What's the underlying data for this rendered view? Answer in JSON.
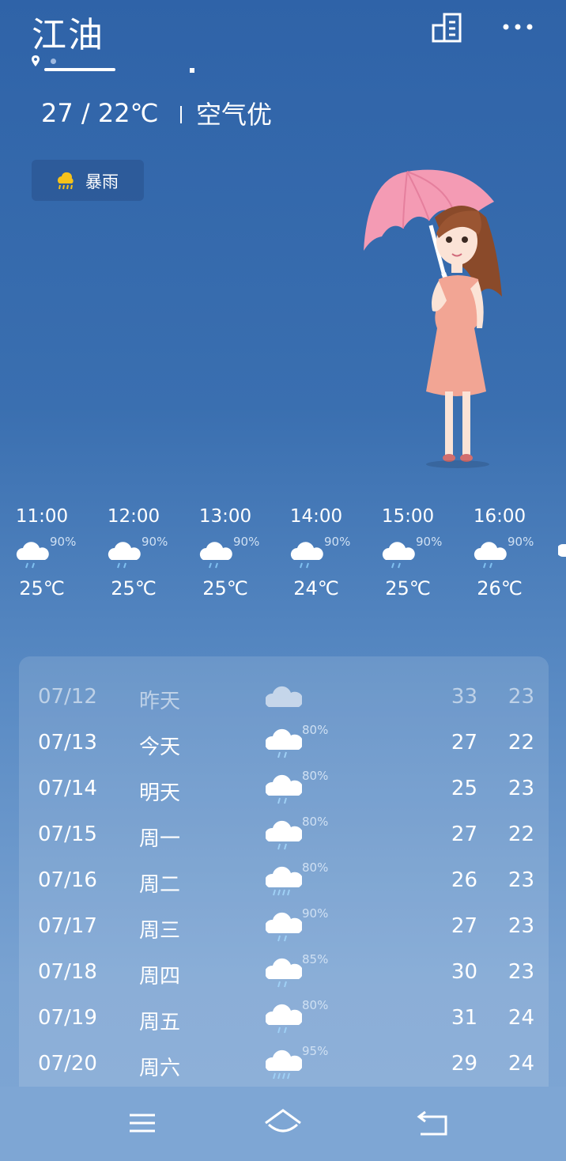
{
  "header": {
    "city": "江油",
    "temp_range": "27  /  22℃",
    "air_quality": "空气优"
  },
  "current": {
    "condition": "暴雨",
    "icon": "cloud-heavy-rain-sun-icon"
  },
  "hourly": [
    {
      "time": "11:00",
      "pct": "90%",
      "temp": "25℃"
    },
    {
      "time": "12:00",
      "pct": "90%",
      "temp": "25℃"
    },
    {
      "time": "13:00",
      "pct": "90%",
      "temp": "25℃"
    },
    {
      "time": "14:00",
      "pct": "90%",
      "temp": "24℃"
    },
    {
      "time": "15:00",
      "pct": "90%",
      "temp": "25℃"
    },
    {
      "time": "16:00",
      "pct": "90%",
      "temp": "26℃"
    }
  ],
  "daily": [
    {
      "date": "07/12",
      "weekday": "昨天",
      "pct": "",
      "icon": "cloud-icon",
      "hi": "33",
      "lo": "23"
    },
    {
      "date": "07/13",
      "weekday": "今天",
      "pct": "80%",
      "icon": "cloud-rain-icon",
      "hi": "27",
      "lo": "22"
    },
    {
      "date": "07/14",
      "weekday": "明天",
      "pct": "80%",
      "icon": "cloud-rain-icon",
      "hi": "25",
      "lo": "23"
    },
    {
      "date": "07/15",
      "weekday": "周一",
      "pct": "80%",
      "icon": "cloud-rain-icon",
      "hi": "27",
      "lo": "22"
    },
    {
      "date": "07/16",
      "weekday": "周二",
      "pct": "80%",
      "icon": "cloud-heavy-rain-icon",
      "hi": "26",
      "lo": "23"
    },
    {
      "date": "07/17",
      "weekday": "周三",
      "pct": "90%",
      "icon": "cloud-rain-icon",
      "hi": "27",
      "lo": "23"
    },
    {
      "date": "07/18",
      "weekday": "周四",
      "pct": "85%",
      "icon": "cloud-rain-icon",
      "hi": "30",
      "lo": "23"
    },
    {
      "date": "07/19",
      "weekday": "周五",
      "pct": "80%",
      "icon": "cloud-rain-icon",
      "hi": "31",
      "lo": "24"
    },
    {
      "date": "07/20",
      "weekday": "周六",
      "pct": "95%",
      "icon": "cloud-heavy-rain-icon",
      "hi": "29",
      "lo": "24"
    }
  ],
  "colors": {
    "bg_top": "#2f63a8",
    "bg_bottom": "#7ea6d4",
    "secondary_text": "#cfe0f3"
  },
  "navbar": {
    "icons": [
      "menu-icon",
      "home-icon",
      "back-icon"
    ]
  }
}
